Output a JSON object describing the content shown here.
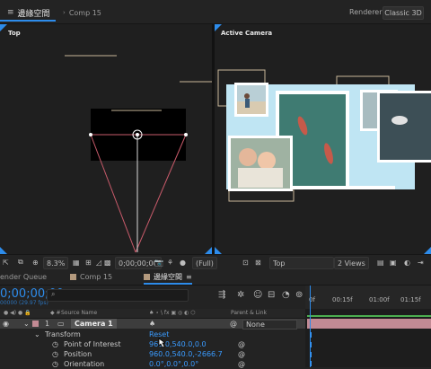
{
  "top_bar": {
    "active_comp_tab": "邊緣空間",
    "comp15_tab": "Comp 15",
    "renderer_label": "Renderer:",
    "renderer_value": "Classic 3D"
  },
  "viewers": {
    "left_label": "Top",
    "right_label": "Active Camera"
  },
  "viewer_toolbar": {
    "zoom": "8.3%",
    "timecode": "0;00;00;00",
    "resolution": "(Full)",
    "view": "Top",
    "views_layout": "2 Views"
  },
  "timeline_tabs": {
    "render_queue": "ender Queue",
    "comp15": "Comp 15",
    "active_comp": "邊緣空間"
  },
  "timeline": {
    "timecode": "0;00;00;00",
    "fps": "00000 (29.97 fps)",
    "search_placeholder": "",
    "ruler_ticks": [
      "0f",
      "00:15f",
      "01:00f",
      "01:15f"
    ]
  },
  "layer_header": {
    "source_name": "Source Name",
    "parent_link": "Parent & Link"
  },
  "layers": {
    "camera": {
      "number": "1",
      "name": "Camera 1",
      "parent": "None"
    },
    "transform": {
      "label": "Transform",
      "reset": "Reset"
    },
    "point_of_interest": {
      "label": "Point of Interest",
      "value": "960.0,540.0,0.0"
    },
    "position": {
      "label": "Position",
      "value": "960.0,540.0,-2666.7"
    },
    "orientation": {
      "label": "Orientation",
      "value": "0.0°,0.0°,0.0°"
    }
  },
  "colors": {
    "accent": "#2d8ceb",
    "camera_label": "#c28a94",
    "camera_lines": "#c95b6b"
  }
}
